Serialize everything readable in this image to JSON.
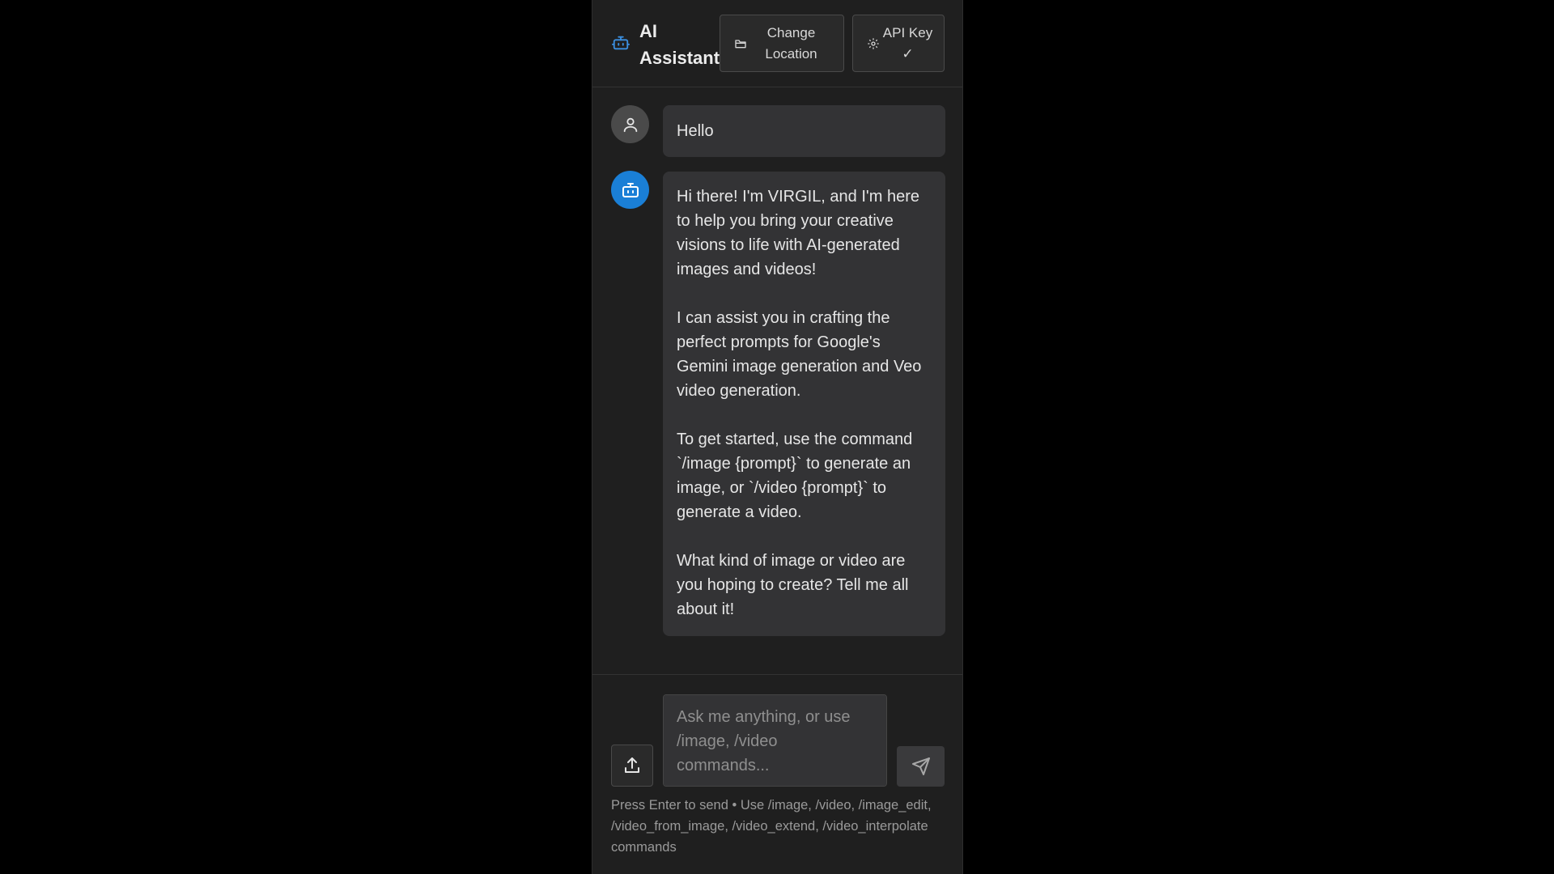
{
  "header": {
    "title": "AI Assistant",
    "logo_icon": "robot-icon",
    "change_location_label": "Change Location",
    "change_location_icon": "folder-icon",
    "api_key_label": "API Key ✓",
    "api_key_icon": "gear-icon"
  },
  "messages": {
    "user": {
      "avatar_icon": "user-icon",
      "text": "Hello"
    },
    "assistant": {
      "avatar_icon": "robot-icon",
      "paragraphs": [
        "Hi there! I'm VIRGIL, and I'm here to help you bring your creative visions to life with AI-generated images and videos!",
        "I can assist you in crafting the perfect prompts for Google's Gemini image generation and Veo video generation.",
        "To get started, use the command `/image {prompt}` to generate an image, or `/video {prompt}` to generate a video.",
        "What kind of image or video are you hoping to create? Tell me all about it!"
      ]
    }
  },
  "composer": {
    "upload_icon": "upload-icon",
    "input_value": "",
    "input_placeholder": "Ask me anything, or use /image, /video commands...",
    "send_icon": "send-icon",
    "hint": "Press Enter to send • Use /image, /video, /image_edit, /video_from_image, /video_extend, /video_interpolate commands"
  },
  "colors": {
    "background": "#1f1f1f",
    "bubble": "#333335",
    "accent": "#1a7fd6"
  }
}
